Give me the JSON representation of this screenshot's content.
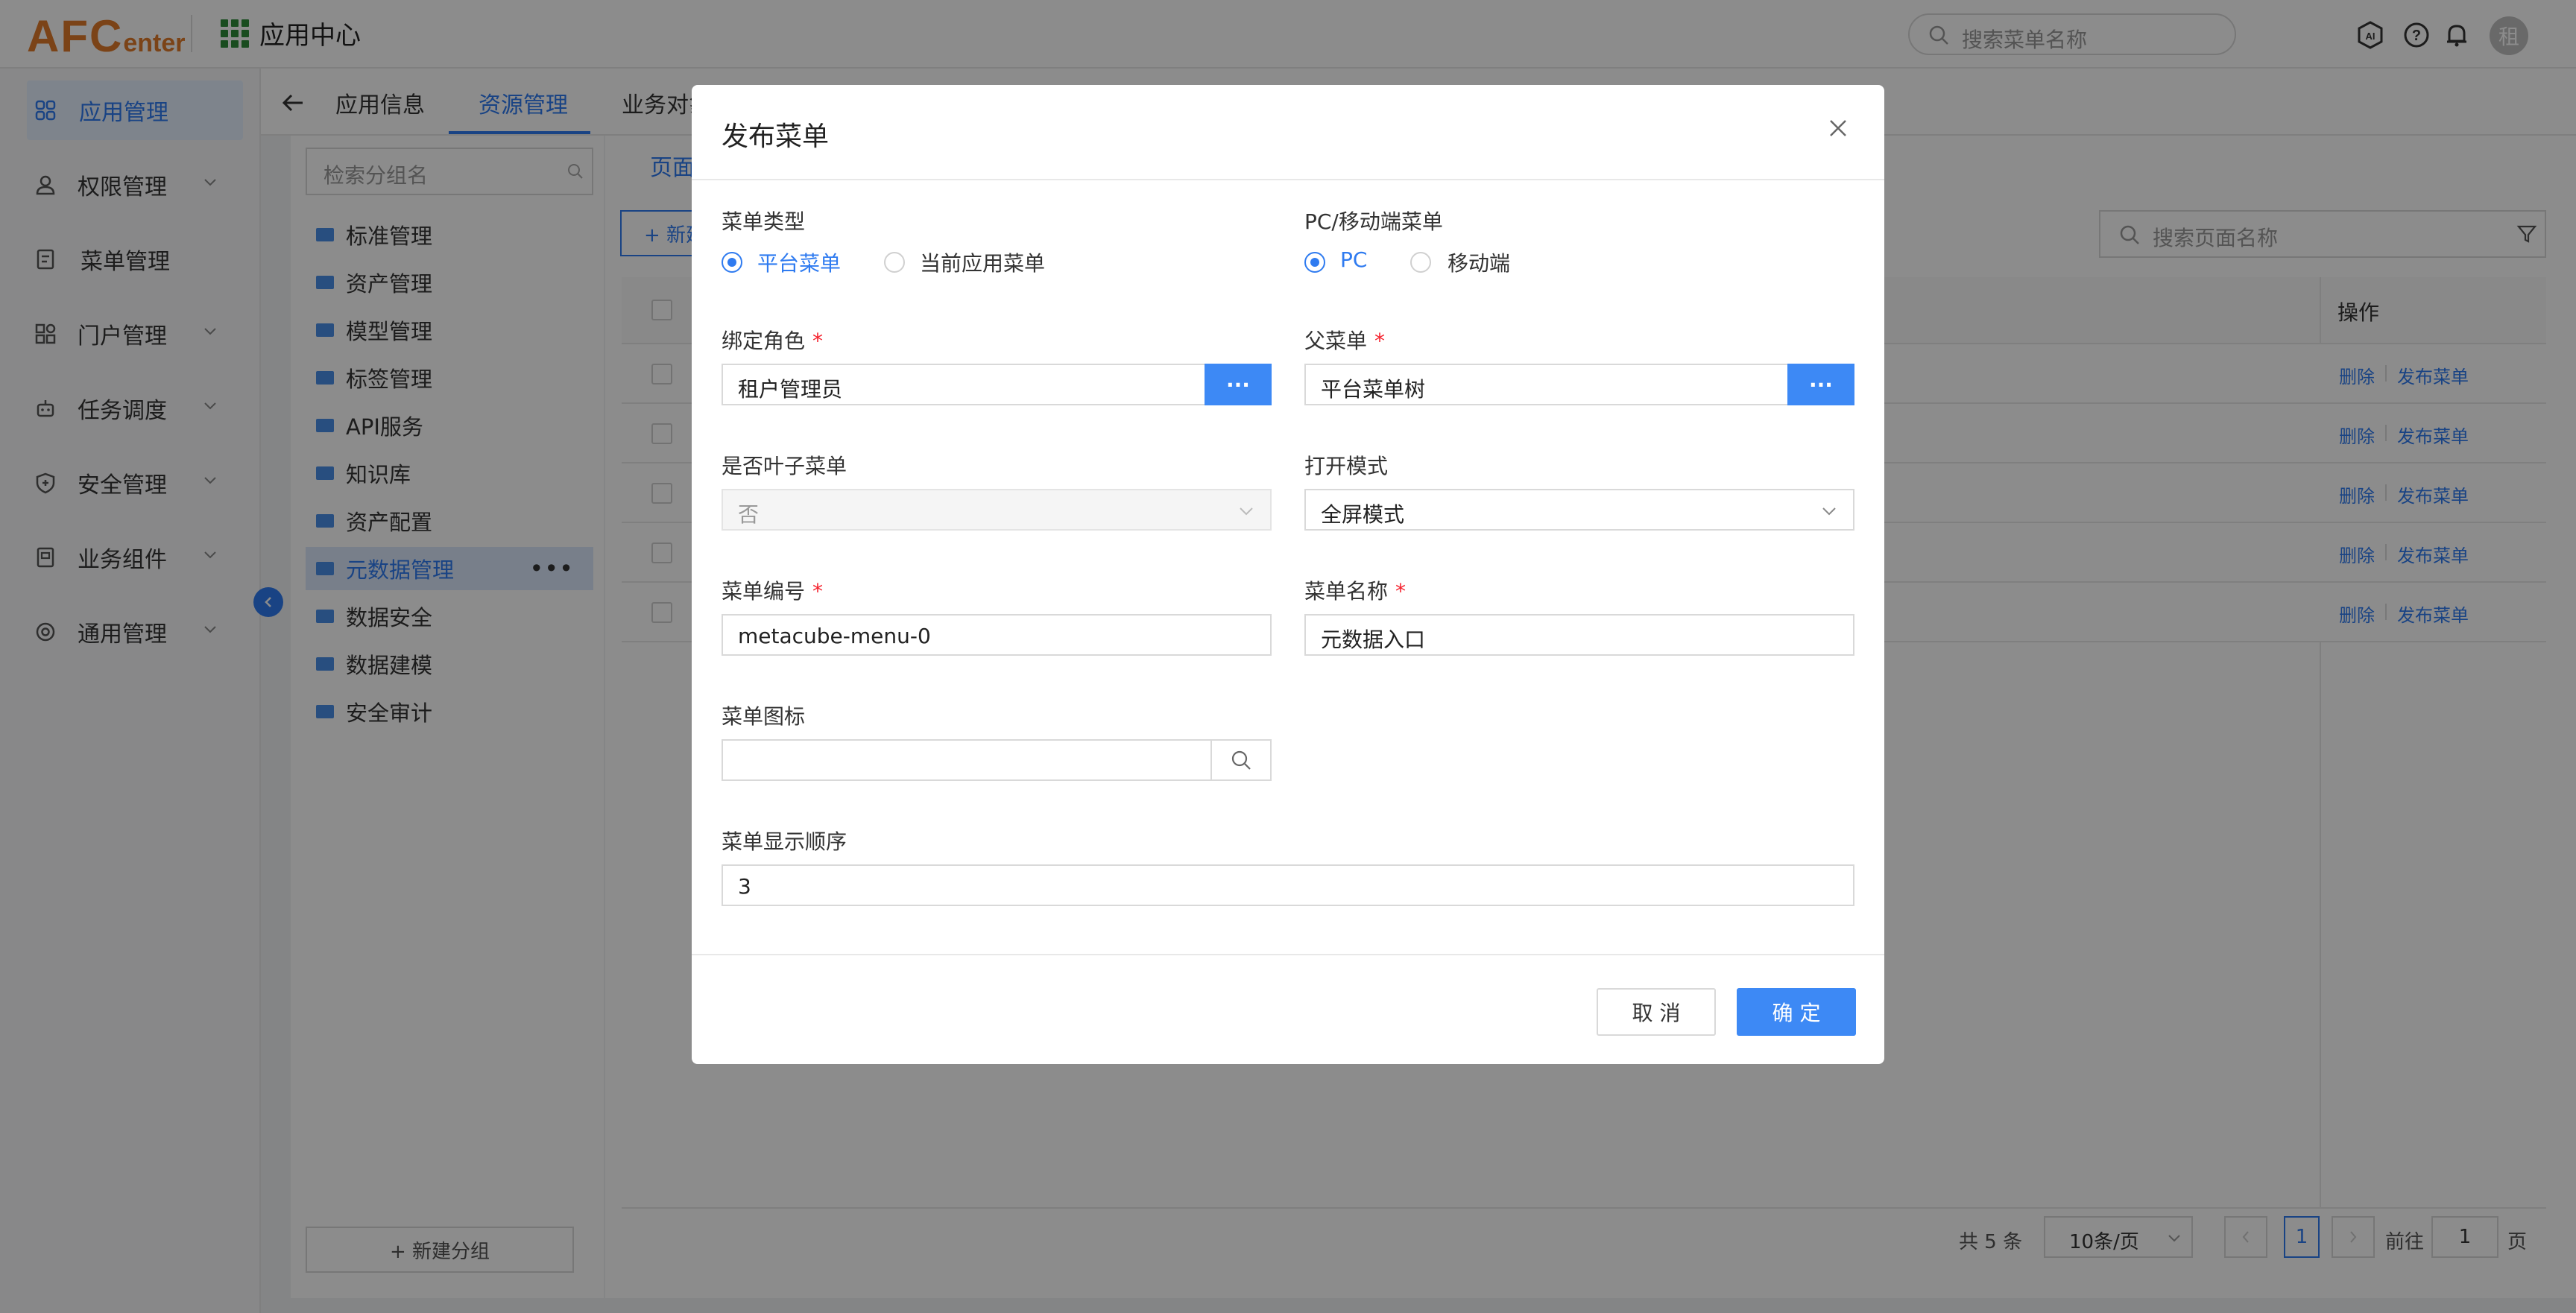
{
  "header": {
    "logo_main": "AFC",
    "logo_sub": "enter",
    "app_center": "应用中心",
    "search_placeholder": "搜索菜单名称",
    "avatar_text": "租",
    "ai_icon": "ai-icon",
    "help_icon": "help-icon",
    "bell_icon": "bell-icon"
  },
  "sidebar": {
    "items": [
      {
        "label": "应用管理",
        "icon": "apps-icon",
        "active": true
      },
      {
        "label": "权限管理",
        "icon": "user-icon",
        "expandable": true
      },
      {
        "label": "菜单管理",
        "icon": "doc-icon"
      },
      {
        "label": "门户管理",
        "icon": "portal-icon",
        "expandable": true
      },
      {
        "label": "任务调度",
        "icon": "robot-icon",
        "expandable": true
      },
      {
        "label": "安全管理",
        "icon": "shield-icon",
        "expandable": true
      },
      {
        "label": "业务组件",
        "icon": "component-icon",
        "expandable": true
      },
      {
        "label": "通用管理",
        "icon": "settings-icon",
        "expandable": true
      }
    ]
  },
  "tabs": [
    {
      "label": "应用信息"
    },
    {
      "label": "资源管理",
      "active": true
    },
    {
      "label": "业务对象"
    }
  ],
  "groups": {
    "search_placeholder": "检索分组名",
    "items": [
      "标准管理",
      "资产管理",
      "模型管理",
      "标签管理",
      "API服务",
      "知识库",
      "资产配置",
      "元数据管理",
      "数据安全",
      "数据建模",
      "安全审计"
    ],
    "active_index": 7,
    "more_label": "•••",
    "new_group_label": "+ 新建分组"
  },
  "table": {
    "subtab_label": "页面",
    "new_button_label": "+ 新建",
    "search_placeholder": "搜索页面名称",
    "ops_header": "操作",
    "rows": [
      {
        "delete": "删除",
        "publish": "发布菜单"
      },
      {
        "delete": "删除",
        "publish": "发布菜单"
      },
      {
        "delete": "删除",
        "publish": "发布菜单"
      },
      {
        "delete": "删除",
        "publish": "发布菜单"
      },
      {
        "delete": "删除",
        "publish": "发布菜单"
      }
    ]
  },
  "pagination": {
    "total": "共 5 条",
    "page_size": "10条/页",
    "current": "1",
    "goto_label": "前往",
    "goto_value": "1",
    "page_unit": "页"
  },
  "modal": {
    "title": "发布菜单",
    "menu_type_label": "菜单类型",
    "menu_type_options": [
      "平台菜单",
      "当前应用菜单"
    ],
    "menu_type_selected": 0,
    "device_label": "PC/移动端菜单",
    "device_options": [
      "PC",
      "移动端"
    ],
    "device_selected": 0,
    "role_label": "绑定角色",
    "role_value": "租户管理员",
    "parent_label": "父菜单",
    "parent_value": "平台菜单树",
    "dots_label": "···",
    "leaf_label": "是否叶子菜单",
    "leaf_value": "否",
    "open_mode_label": "打开模式",
    "open_mode_value": "全屏模式",
    "code_label": "菜单编号",
    "code_value": "metacube-menu-0",
    "name_label": "菜单名称",
    "name_value": "元数据入口",
    "icon_label": "菜单图标",
    "icon_value": "",
    "order_label": "菜单显示顺序",
    "order_value": "3",
    "required_mark": "*",
    "cancel_label": "取 消",
    "ok_label": "确 定"
  },
  "colors": {
    "primary": "#2f7bf0",
    "button": "#3d89f5",
    "logo": "#e07b2a",
    "required": "#f5222d"
  }
}
